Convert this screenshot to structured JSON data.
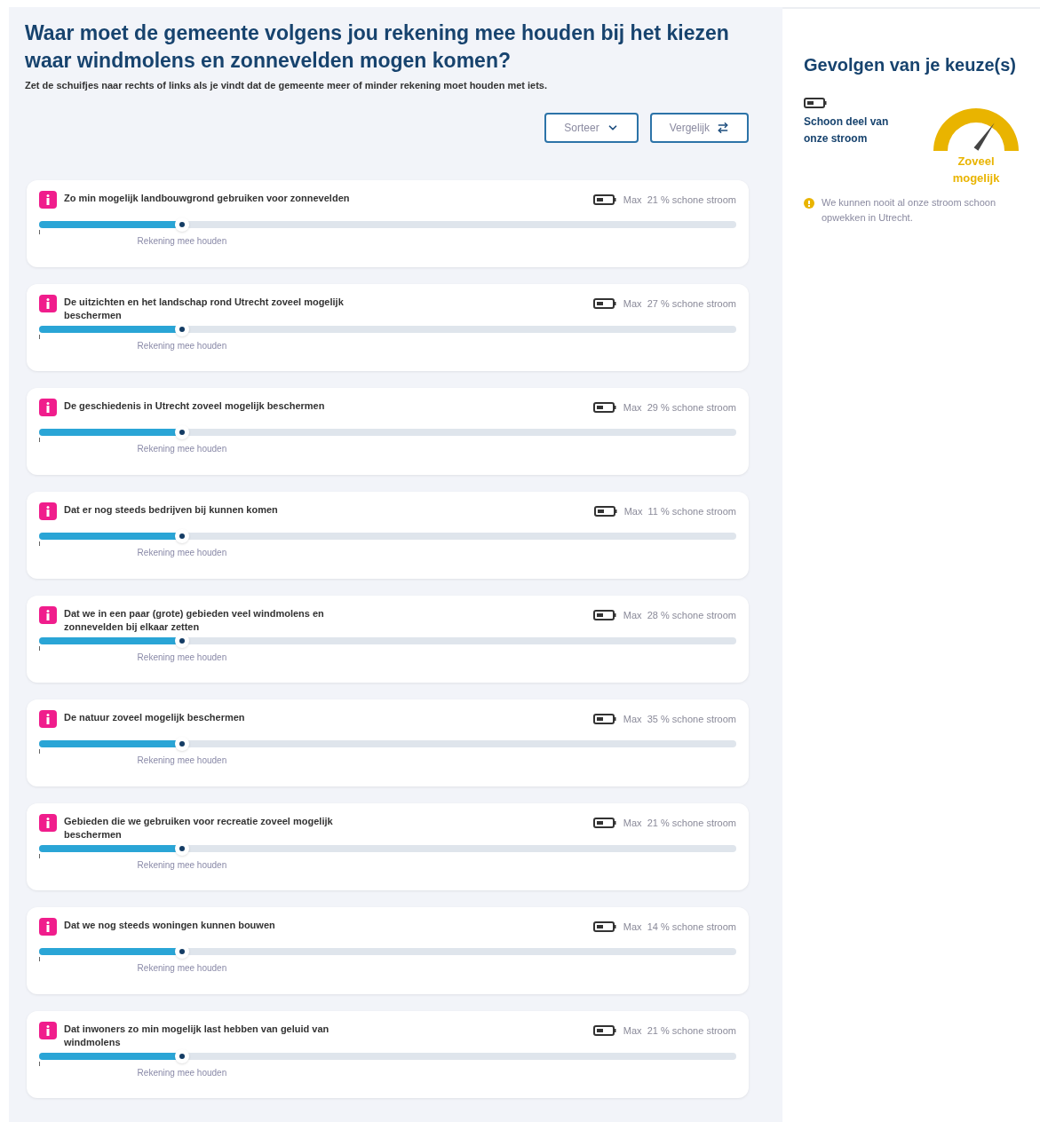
{
  "header": {
    "title": "Waar moet de gemeente volgens jou rekening mee houden bij het kiezen waar windmolens en zonnevelden mogen komen?",
    "subtitle": "Zet de schuifjes naar rechts of links als je vindt dat de gemeente meer of minder rekening moet houden met iets."
  },
  "buttons": [
    {
      "label": "Sorteer",
      "kind": "sort"
    },
    {
      "label": "Vergelijk",
      "kind": "compare"
    }
  ],
  "criteria": [
    {
      "title": "Zo min mogelijk landbouwgrond gebruiken voor zonnevelden",
      "max": "Max  21 % schone stroom",
      "level": 0.205,
      "slider_label": "Rekening mee houden"
    },
    {
      "title": "De uitzichten en het landschap rond Utrecht zoveel mogelijk beschermen",
      "max": "Max  27 % schone stroom",
      "level": 0.205,
      "slider_label": "Rekening mee houden"
    },
    {
      "title": "De geschiedenis in Utrecht zoveel mogelijk beschermen",
      "max": "Max  29 % schone stroom",
      "level": 0.205,
      "slider_label": "Rekening mee houden"
    },
    {
      "title": "Dat er nog steeds bedrijven bij kunnen komen",
      "max": "Max  11 % schone stroom",
      "level": 0.205,
      "slider_label": "Rekening mee houden"
    },
    {
      "title": "Dat we in een paar (grote) gebieden veel windmolens en zonnevelden bij elkaar zetten",
      "max": "Max  28 % schone stroom",
      "level": 0.205,
      "slider_label": "Rekening mee houden"
    },
    {
      "title": "De natuur zoveel mogelijk beschermen",
      "max": "Max  35 % schone stroom",
      "level": 0.205,
      "slider_label": "Rekening mee houden"
    },
    {
      "title": "Gebieden die we gebruiken voor recreatie zoveel mogelijk beschermen",
      "max": "Max  21 % schone stroom",
      "level": 0.205,
      "slider_label": "Rekening mee houden"
    },
    {
      "title": "Dat we nog steeds woningen kunnen bouwen",
      "max": "Max  14 % schone stroom",
      "level": 0.205,
      "slider_label": "Rekening mee houden"
    },
    {
      "title": "Dat inwoners zo min mogelijk last hebben van geluid van windmolens",
      "max": "Max  21 % schone stroom",
      "level": 0.205,
      "slider_label": "Rekening mee houden"
    }
  ],
  "results": {
    "title": "Gevolgen van je keuze(s)",
    "metric": "Schoon deel van onze stroom",
    "gauge_label": "Zoveel mogelijk",
    "note": "We kunnen nooit al onze stroom schoon opwekken in Utrecht."
  }
}
